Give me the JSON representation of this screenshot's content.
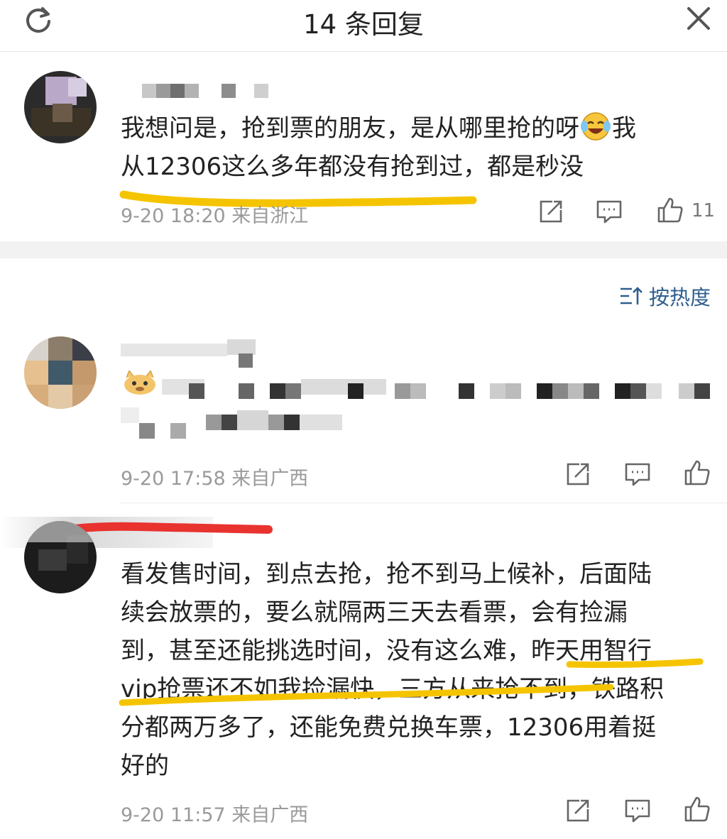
{
  "header": {
    "title": "14 条回复"
  },
  "top_comment": {
    "text_line1": "我想问是，抢到票的朋友，是从哪里抢的呀",
    "text_line1_tail": "我",
    "text_line2": "从12306这么多年都没有抢到过，都是秒没",
    "meta": "9-20 18:20 来自浙江",
    "likes": "11"
  },
  "sort": {
    "label": "按热度"
  },
  "replies": [
    {
      "meta": "9-20 17:58 来自广西"
    },
    {
      "text_lines": [
        "看发售时间，到点去抢，抢不到马上候补，后面陆",
        "续会放票的，要么就隔两三天去看票，会有捡漏",
        "到，甚至还能挑选时间，没有这么难，昨天用智行",
        "vip抢票还不如我捡漏快，三方从来抢不到，铁路积",
        "分都两万多了，还能免费兑换车票，12306用着挺",
        "好的"
      ],
      "meta": "9-20 11:57 来自广西"
    }
  ],
  "colors": {
    "highlight_yellow": "#f5c400",
    "highlight_red": "#e8332f",
    "link_blue": "#2f5e8e"
  }
}
